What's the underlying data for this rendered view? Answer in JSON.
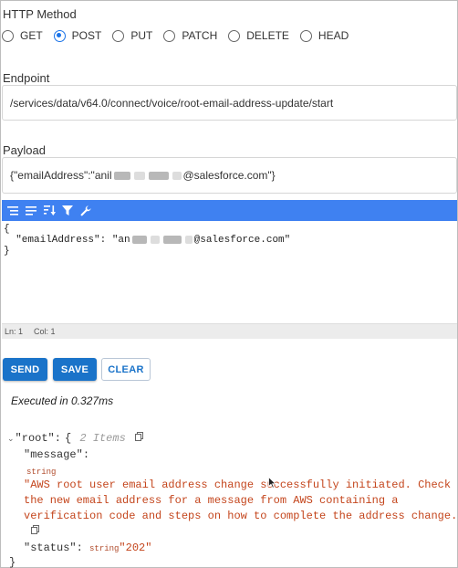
{
  "http_method": {
    "label": "HTTP Method",
    "options": [
      "GET",
      "POST",
      "PUT",
      "PATCH",
      "DELETE",
      "HEAD"
    ],
    "selected": "POST"
  },
  "endpoint": {
    "label": "Endpoint",
    "value": "/services/data/v64.0/connect/voice/root-email-address-update/start"
  },
  "payload": {
    "label": "Payload",
    "value_prefix": "{\"emailAddress\":\"anil",
    "value_suffix": "@salesforce.com\"}"
  },
  "editor": {
    "line1": "{",
    "line2_prefix": "  \"emailAddress\": \"an",
    "line2_suffix": "@salesforce.com\"",
    "line3": "}",
    "status_ln": "Ln: 1",
    "status_col": "Col: 1"
  },
  "buttons": {
    "send": "SEND",
    "save": "SAVE",
    "clear": "CLEAR"
  },
  "result": {
    "executed": "Executed in 0.327ms",
    "root_key": "\"root\"",
    "root_colon": ":",
    "root_brace": "{",
    "root_count": "2 Items",
    "message_key": "\"message\"",
    "message_colon": ":",
    "message_type": "string",
    "message_line1": "\"AWS root user email address change successfully initiated. Check",
    "message_line2": "the new email address for a message from AWS containing a",
    "message_line3": "verification code and steps on how to complete the address change.\"",
    "status_key": "\"status\"",
    "status_colon": ":",
    "status_type": "string",
    "status_value": "\"202\"",
    "close_brace": "}"
  },
  "colors": {
    "primary": "#1a73c9",
    "toolbar": "#3f81f1",
    "string_value": "#c4451c"
  }
}
